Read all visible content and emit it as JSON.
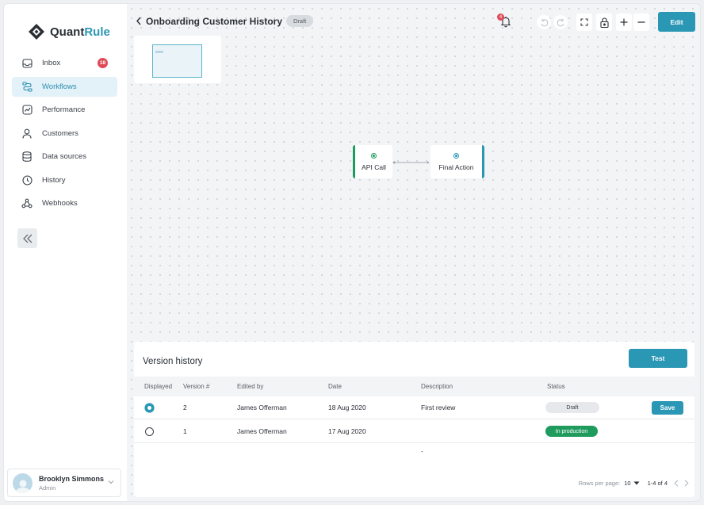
{
  "brand": {
    "name_main": "Quant",
    "name_accent": "Rule",
    "accent_color": "#2a97b5"
  },
  "sidebar": {
    "items": [
      {
        "label": "Inbox",
        "icon": "inbox-icon",
        "badge": "18"
      },
      {
        "label": "Workflows",
        "icon": "workflow-icon",
        "active": true
      },
      {
        "label": "Performance",
        "icon": "performance-icon"
      },
      {
        "label": "Customers",
        "icon": "user-icon"
      },
      {
        "label": "Data sources",
        "icon": "database-icon"
      },
      {
        "label": "History",
        "icon": "clock-icon"
      },
      {
        "label": "Webhooks",
        "icon": "webhook-icon"
      }
    ],
    "collapse_icon": "double-chevron-left-icon",
    "user": {
      "name": "Brooklyn Simmons",
      "role": "Admin"
    }
  },
  "header": {
    "title": "Onboarding Customer History",
    "status": "Draft",
    "notifications_count": "4",
    "edit_label": "Edit"
  },
  "workflow": {
    "nodes": [
      {
        "label": "API Call",
        "color": "#1f9b5e"
      },
      {
        "label": "Final Action",
        "color": "#2a97b5"
      }
    ]
  },
  "version_history": {
    "title": "Version history",
    "test_label": "Test",
    "columns": [
      "Displayed",
      "Version #",
      "Edited by",
      "Date",
      "Description",
      "Status"
    ],
    "rows": [
      {
        "displayed": true,
        "version": "2",
        "edited_by": "James Offerman",
        "date": "18 Aug 2020",
        "description": "First review",
        "status": "Draft",
        "action": "Save"
      },
      {
        "displayed": false,
        "version": "1",
        "edited_by": "James Offerman",
        "date": "17 Aug 2020",
        "description": "",
        "status": "In production"
      }
    ],
    "empty_marker": "-",
    "pagination": {
      "rows_per_page_label": "Rows per page:",
      "rows_per_page": "10",
      "range": "1-4 of 4"
    }
  },
  "colors": {
    "primary": "#2a97b5",
    "success": "#1f9b5e",
    "danger": "#e04a57"
  }
}
